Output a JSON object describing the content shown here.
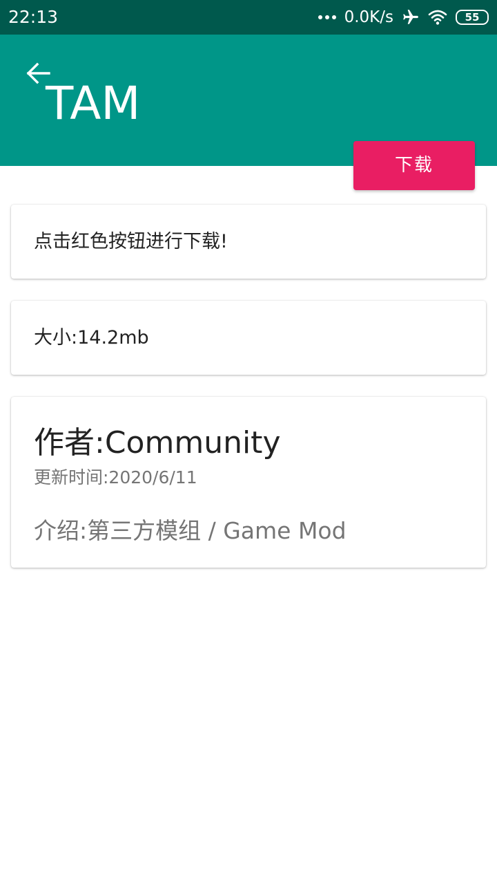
{
  "status_bar": {
    "time": "22:13",
    "network_speed": "0.0K/s",
    "battery_level": "55",
    "icons": [
      "more-dots-icon",
      "airplane-icon",
      "wifi-icon",
      "battery-icon"
    ]
  },
  "app_bar": {
    "title": "TAM",
    "back_icon": "arrow-left-icon",
    "background_color": "#009688"
  },
  "download_button": {
    "label": "下载",
    "color": "#e91e63"
  },
  "cards": {
    "hint": "点击红色按钮进行下载!",
    "size": "大小:14.2mb",
    "author": "作者:Community",
    "update_time": "更新时间:2020/6/11",
    "intro": "介绍:第三方模组 / Game Mod"
  }
}
